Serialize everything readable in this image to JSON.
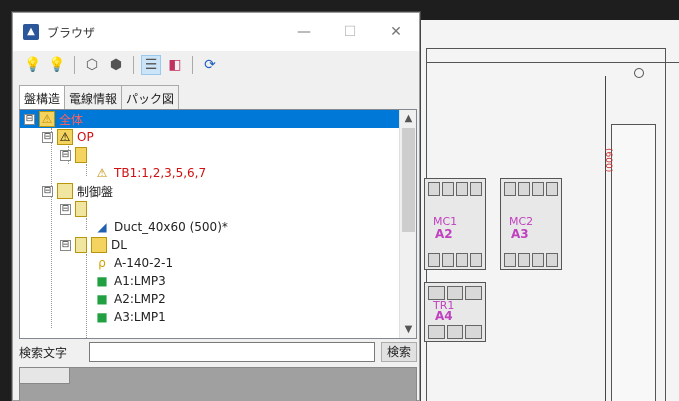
{
  "window": {
    "title": "ブラウザ",
    "minimize": "—",
    "maximize": "☐",
    "close": "✕"
  },
  "toolbar": {
    "buttons": [
      "bulb-on-icon",
      "bulb-off-icon",
      "cube-icon",
      "cube-open-icon",
      "list-icon",
      "layers-icon",
      "refresh-icon"
    ]
  },
  "tabs": [
    "盤構造",
    "電線情報",
    "パック図"
  ],
  "tree": {
    "items": [
      {
        "label": "全体",
        "color": "red",
        "level": 0,
        "expander": "⊟"
      },
      {
        "label": "OP",
        "color": "red",
        "level": 1,
        "expander": "⊟"
      },
      {
        "label": "",
        "color": "black",
        "level": 2,
        "expander": "⊟"
      },
      {
        "label": "TB1:1,2,3,5,6,7",
        "color": "red",
        "level": 3
      },
      {
        "label": "制御盤",
        "color": "black",
        "level": 1,
        "expander": "⊟"
      },
      {
        "label": "",
        "color": "black",
        "level": 2,
        "expander": "⊟"
      },
      {
        "label": "Duct_40x60 (500)*",
        "color": "black",
        "level": 3
      },
      {
        "label": "DL",
        "color": "black",
        "level": 2,
        "expander": "⊟"
      },
      {
        "label": "A-140-2-1",
        "color": "black",
        "level": 3
      },
      {
        "label": "A1:LMP3",
        "color": "black",
        "level": 3
      },
      {
        "label": "A2:LMP2",
        "color": "black",
        "level": 3
      },
      {
        "label": "A3:LMP1",
        "color": "black",
        "level": 3
      }
    ]
  },
  "search": {
    "label": "検索文字",
    "value": "",
    "button": "検索"
  },
  "cad": {
    "contactors": [
      {
        "id": "MC1",
        "ref": "A2"
      },
      {
        "id": "MC2",
        "ref": "A3"
      },
      {
        "id": "TR1",
        "ref": "A4"
      }
    ],
    "door_text": "(600)"
  },
  "colors": {
    "selection": "#0078d7",
    "red_label": "#d01010",
    "magenta_label": "#c040c0"
  }
}
